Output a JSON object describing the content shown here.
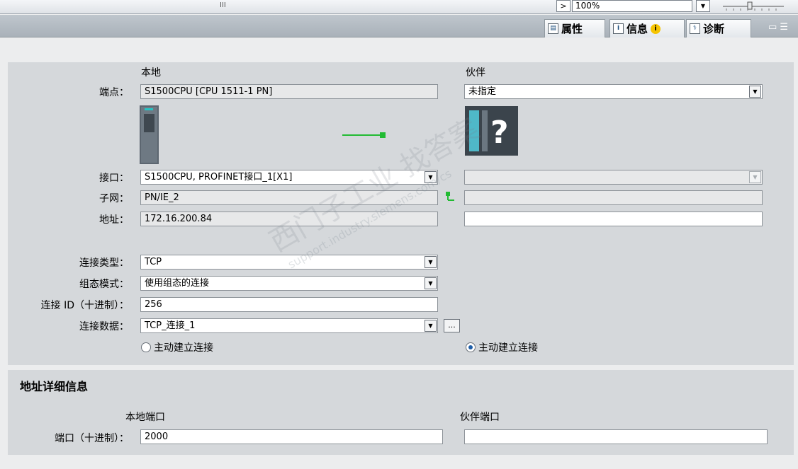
{
  "toolbar": {
    "zoom": "100%"
  },
  "tabs": [
    {
      "label": "属性",
      "icon": "properties-icon"
    },
    {
      "label": "信息",
      "icon": "info-icon"
    },
    {
      "label": "诊断",
      "icon": "diagnostics-icon"
    }
  ],
  "connection": {
    "local_header": "本地",
    "partner_header": "伙伴",
    "endpoint_label": "端点：",
    "endpoint_local": "S1500CPU [CPU 1511-1 PN]",
    "endpoint_partner": "未指定",
    "interface_label": "接口：",
    "interface_local": "S1500CPU, PROFINET接口_1[X1]",
    "subnet_label": "子网：",
    "subnet_local": "PN/IE_2",
    "address_label": "地址：",
    "address_local": "172.16.200.84",
    "conn_type_label": "连接类型：",
    "conn_type": "TCP",
    "config_mode_label": "组态模式：",
    "config_mode": "使用组态的连接",
    "conn_id_label": "连接 ID（十进制）：",
    "conn_id": "256",
    "conn_data_label": "连接数据：",
    "conn_data": "TCP_连接_1",
    "ellipsis": "...",
    "active_local": "主动建立连接",
    "active_partner": "主动建立连接",
    "unknown_device_glyph": "?"
  },
  "address_details": {
    "title": "地址详细信息",
    "local_port_header": "本地端口",
    "partner_port_header": "伙伴端口",
    "port_label": "端口（十进制）：",
    "local_port": "2000",
    "partner_port": ""
  },
  "watermark": {
    "text_cn": "西门子工业 找答案",
    "text_en": "support.industry.siemens.com/cs"
  },
  "colors": {
    "link_green": "#22bb33",
    "radio_selected": "#1e5ea8",
    "device_teal": "#4fb8c8"
  }
}
